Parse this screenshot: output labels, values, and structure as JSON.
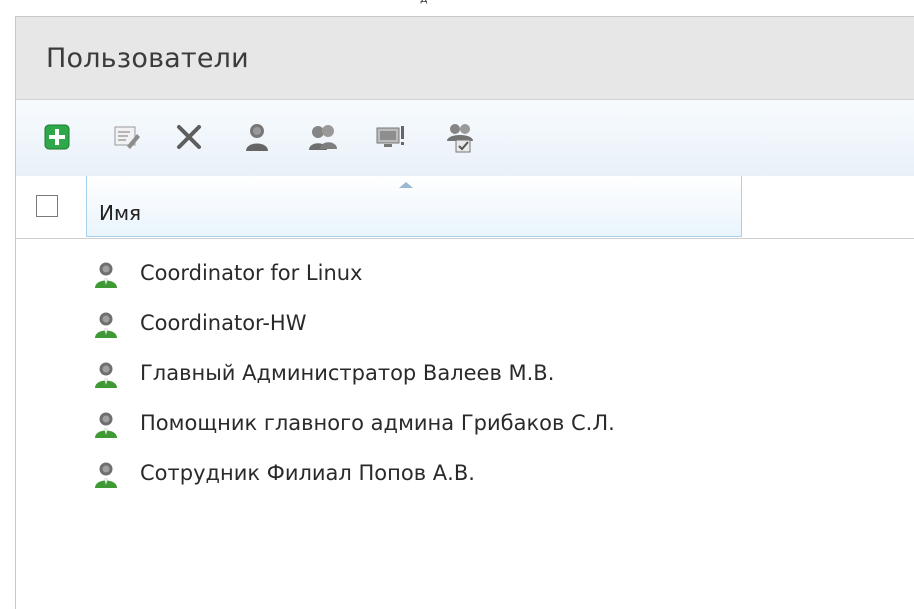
{
  "top_strip_text": "д",
  "panel": {
    "title": "Пользователи"
  },
  "toolbar": {
    "buttons": [
      {
        "name": "add-button",
        "icon": "plus-icon"
      },
      {
        "name": "edit-button",
        "icon": "edit-properties-icon"
      },
      {
        "name": "delete-button",
        "icon": "delete-x-icon"
      },
      {
        "name": "user-button",
        "icon": "user-icon"
      },
      {
        "name": "users-group-button",
        "icon": "users-group-icon"
      },
      {
        "name": "computer-message-button",
        "icon": "computer-message-icon"
      },
      {
        "name": "users-check-button",
        "icon": "users-check-icon"
      }
    ]
  },
  "table": {
    "column_name": "Имя",
    "rows": [
      {
        "name": "Coordinator for Linux",
        "icon": "user-icon"
      },
      {
        "name": "Coordinator-HW",
        "icon": "user-icon"
      },
      {
        "name": "Главный Администратор Валеев М.В.",
        "icon": "user-icon"
      },
      {
        "name": "Помощник главного админа Грибаков С.Л.",
        "icon": "user-icon"
      },
      {
        "name": "Сотрудник Филиал Попов А.В.",
        "icon": "user-icon"
      }
    ]
  },
  "colors": {
    "title_bg": "#e7e7e7",
    "toolbar_bg": "#eef5fb",
    "header_selected_border": "#a8d1ef",
    "user_icon_green": "#3f9a35"
  }
}
